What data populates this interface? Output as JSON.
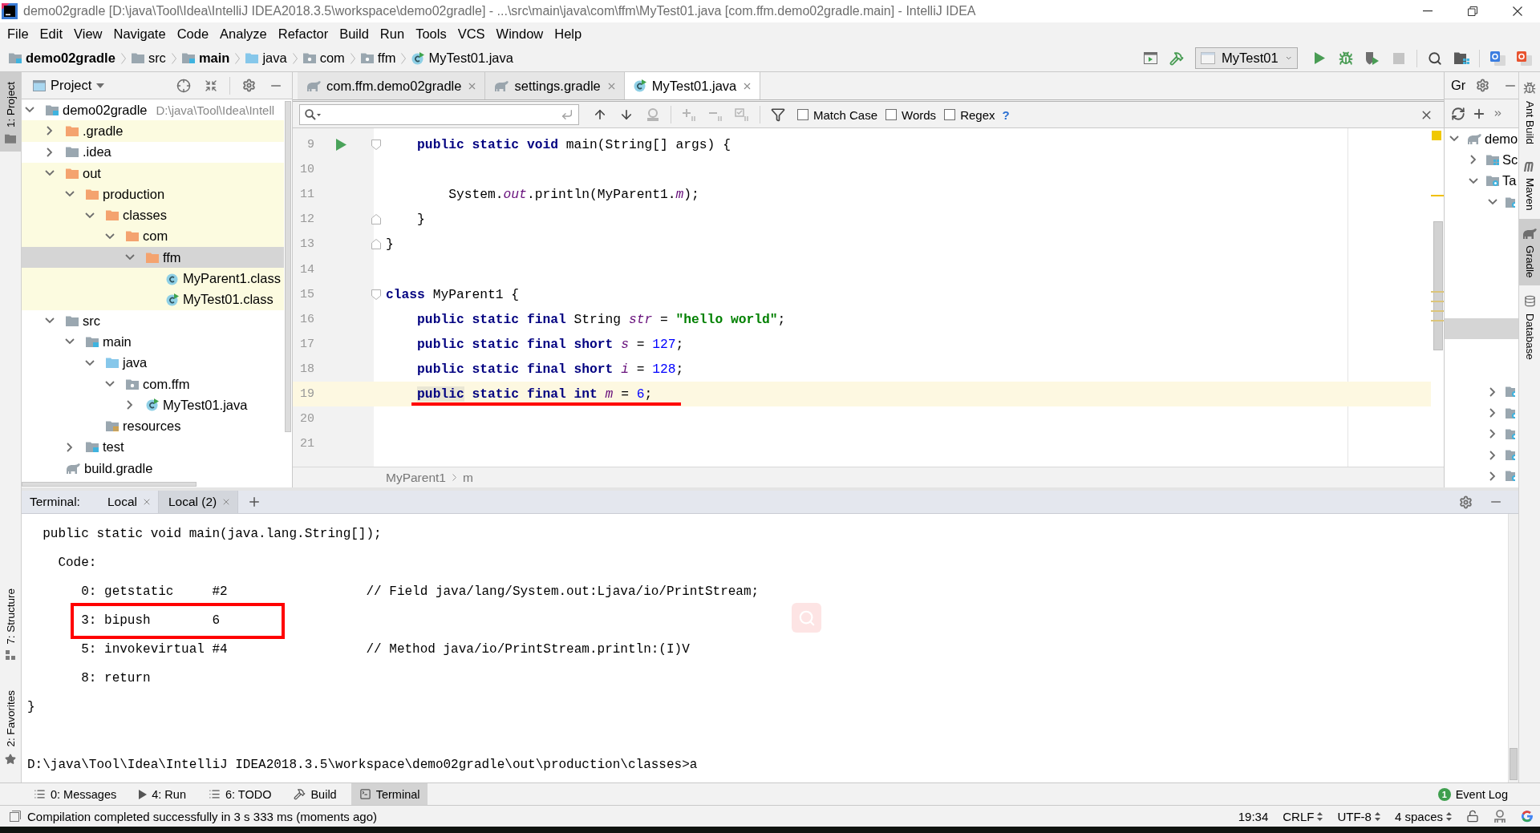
{
  "window": {
    "title": "demo02gradle [D:\\java\\Tool\\Idea\\IntelliJ IDEA2018.3.5\\workspace\\demo02gradle] - ...\\src\\main\\java\\com\\ffm\\MyTest01.java [com.ffm.demo02gradle.main] - IntelliJ IDEA"
  },
  "menu": [
    "File",
    "Edit",
    "View",
    "Navigate",
    "Code",
    "Analyze",
    "Refactor",
    "Build",
    "Run",
    "Tools",
    "VCS",
    "Window",
    "Help"
  ],
  "navbar": {
    "breadcrumbs": [
      {
        "label": "demo02gradle",
        "kind": "module"
      },
      {
        "label": "src",
        "kind": "folder"
      },
      {
        "label": "main",
        "kind": "module"
      },
      {
        "label": "java",
        "kind": "source"
      },
      {
        "label": "com",
        "kind": "package"
      },
      {
        "label": "ffm",
        "kind": "package"
      },
      {
        "label": "MyTest01.java",
        "kind": "runnable-class"
      }
    ],
    "run_config": "MyTest01"
  },
  "left_strip": {
    "top": [
      {
        "label": "1: Project",
        "kind": "project",
        "selected": true
      }
    ],
    "bottom": [
      {
        "label": "7: Structure",
        "kind": "structure",
        "selected": false
      },
      {
        "label": "2: Favorites",
        "kind": "favorites",
        "selected": false
      }
    ]
  },
  "project": {
    "title": "Project",
    "tree": [
      {
        "label": "demo02gradle",
        "kind": "module",
        "note": "D:\\java\\Tool\\Idea\\Intell",
        "expanded": true,
        "excluded": false,
        "selected": false,
        "children": [
          {
            "label": ".gradle",
            "kind": "excluded-folder",
            "expanded": false,
            "excluded": true,
            "selected": false
          },
          {
            "label": ".idea",
            "kind": "folder",
            "expanded": false,
            "excluded": false,
            "selected": false
          },
          {
            "label": "out",
            "kind": "excluded-folder",
            "expanded": true,
            "excluded": true,
            "selected": false,
            "children": [
              {
                "label": "production",
                "kind": "excluded-folder",
                "expanded": true,
                "excluded": true,
                "selected": false,
                "children": [
                  {
                    "label": "classes",
                    "kind": "excluded-folder",
                    "expanded": true,
                    "excluded": true,
                    "selected": false,
                    "children": [
                      {
                        "label": "com",
                        "kind": "excluded-folder",
                        "expanded": true,
                        "excluded": true,
                        "selected": false,
                        "children": [
                          {
                            "label": "ffm",
                            "kind": "excluded-folder",
                            "expanded": true,
                            "selected": true,
                            "children": [
                              {
                                "label": "MyParent1.class",
                                "kind": "class",
                                "excluded": true,
                                "selected": false
                              },
                              {
                                "label": "MyTest01.class",
                                "kind": "runnable-class",
                                "excluded": true,
                                "selected": false
                              }
                            ]
                          }
                        ]
                      }
                    ]
                  }
                ]
              }
            ]
          },
          {
            "label": "src",
            "kind": "folder",
            "expanded": true,
            "excluded": false,
            "selected": false,
            "children": [
              {
                "label": "main",
                "kind": "module-folder",
                "expanded": true,
                "excluded": false,
                "selected": false,
                "children": [
                  {
                    "label": "java",
                    "kind": "source",
                    "expanded": true,
                    "excluded": false,
                    "selected": false,
                    "children": [
                      {
                        "label": "com.ffm",
                        "kind": "package",
                        "expanded": true,
                        "excluded": false,
                        "selected": false,
                        "children": [
                          {
                            "label": "MyTest01.java",
                            "kind": "runnable-class",
                            "expanded": false,
                            "excluded": false,
                            "selected": false
                          }
                        ]
                      }
                    ]
                  },
                  {
                    "label": "resources",
                    "kind": "resources",
                    "excluded": false,
                    "selected": false
                  }
                ]
              },
              {
                "label": "test",
                "kind": "module-folder",
                "expanded": false,
                "excluded": false,
                "selected": false
              }
            ]
          },
          {
            "label": "build.gradle",
            "kind": "gradle",
            "excluded": false,
            "selected": false
          }
        ]
      }
    ]
  },
  "editor": {
    "tabs": [
      {
        "label": "com.ffm.demo02gradle",
        "kind": "gradle",
        "selected": false
      },
      {
        "label": "settings.gradle",
        "kind": "gradle",
        "selected": false
      },
      {
        "label": "MyTest01.java",
        "kind": "runnable-class",
        "selected": true
      }
    ],
    "search": {
      "options": [
        {
          "label": "Match Case",
          "checked": false
        },
        {
          "label": "Words",
          "checked": false
        },
        {
          "label": "Regex",
          "checked": false
        }
      ],
      "help": "?"
    },
    "lines": [
      {
        "number": "9",
        "current": false,
        "underlined": false,
        "run_marker": true,
        "fold_start": true,
        "tokens": [
          {
            "kind": "keyword",
            "text": "    public static void"
          },
          {
            "kind": "plain",
            "text": " main(String[] args) {"
          }
        ]
      },
      {
        "number": "10",
        "current": false,
        "underlined": false
      },
      {
        "number": "11",
        "current": false,
        "underlined": false,
        "tokens": [
          {
            "kind": "plain",
            "text": "        System."
          },
          {
            "kind": "field",
            "text": "out"
          },
          {
            "kind": "plain",
            "text": ".println(MyParent1."
          },
          {
            "kind": "field",
            "text": "m"
          },
          {
            "kind": "plain",
            "text": ");"
          }
        ]
      },
      {
        "number": "12",
        "current": false,
        "underlined": false,
        "fold_end": true,
        "tokens": [
          {
            "kind": "plain",
            "text": "    }"
          }
        ]
      },
      {
        "number": "13",
        "current": false,
        "underlined": false,
        "fold_end": true,
        "tokens": [
          {
            "kind": "plain",
            "text": "}"
          }
        ]
      },
      {
        "number": "14",
        "current": false,
        "underlined": false
      },
      {
        "number": "15",
        "current": false,
        "underlined": false,
        "fold_start": true,
        "tokens": [
          {
            "kind": "keyword",
            "text": "class"
          },
          {
            "kind": "plain",
            "text": " MyParent1 {"
          }
        ]
      },
      {
        "number": "16",
        "current": false,
        "underlined": false,
        "tokens": [
          {
            "kind": "keyword",
            "text": "    public static final"
          },
          {
            "kind": "plain",
            "text": " String "
          },
          {
            "kind": "field",
            "text": "str"
          },
          {
            "kind": "plain",
            "text": " = "
          },
          {
            "kind": "string",
            "text": "\"hello world\""
          },
          {
            "kind": "plain",
            "text": ";"
          }
        ]
      },
      {
        "number": "17",
        "current": false,
        "underlined": false,
        "tokens": [
          {
            "kind": "keyword",
            "text": "    public static final short "
          },
          {
            "kind": "field",
            "text": "s"
          },
          {
            "kind": "plain",
            "text": " = "
          },
          {
            "kind": "number",
            "text": "127"
          },
          {
            "kind": "plain",
            "text": ";"
          }
        ]
      },
      {
        "number": "18",
        "current": false,
        "underlined": false,
        "tokens": [
          {
            "kind": "keyword",
            "text": "    public static final short "
          },
          {
            "kind": "field",
            "text": "i"
          },
          {
            "kind": "plain",
            "text": " = "
          },
          {
            "kind": "number",
            "text": "128"
          },
          {
            "kind": "plain",
            "text": ";"
          }
        ]
      },
      {
        "number": "19",
        "current": true,
        "underlined": true,
        "tokens": [
          {
            "kind": "keyword",
            "text": "    public",
            "highlighted": true
          },
          {
            "kind": "keyword",
            "text": " static final int "
          },
          {
            "kind": "field",
            "text": "m"
          },
          {
            "kind": "plain",
            "text": " = "
          },
          {
            "kind": "number",
            "text": "6"
          },
          {
            "kind": "plain",
            "text": ";"
          }
        ]
      },
      {
        "number": "20",
        "current": false,
        "underlined": false
      },
      {
        "number": "21",
        "current": false,
        "underlined": false
      }
    ],
    "breadcrumbs": [
      "MyParent1",
      "m"
    ]
  },
  "gradle": {
    "title": "Gr",
    "tree": [
      {
        "label": "demo",
        "kind": "gradle",
        "expanded": true,
        "selected": false,
        "children": [
          {
            "label": "Sc",
            "kind": "source-sets",
            "expanded": false,
            "selected": false
          },
          {
            "label": "Ta",
            "kind": "tasks",
            "expanded": true,
            "selected": false,
            "children": [
              {
                "kind": "task-folder",
                "expanded": true,
                "selected": false,
                "children": [
                  {
                    "selected": false
                  },
                  {
                    "selected": false
                  },
                  {
                    "selected": false
                  },
                  {
                    "selected": false
                  },
                  {
                    "selected": false
                  },
                  {
                    "selected": true
                  },
                  {
                    "selected": false
                  },
                  {
                    "selected": false
                  }
                ]
              },
              {
                "kind": "task-folder",
                "expanded": false,
                "selected": false
              },
              {
                "kind": "task-folder",
                "expanded": false,
                "selected": false
              },
              {
                "kind": "task-folder",
                "expanded": false,
                "selected": false
              },
              {
                "kind": "task-folder",
                "expanded": false,
                "selected": false
              },
              {
                "kind": "task-folder",
                "expanded": false,
                "selected": false
              }
            ]
          }
        ]
      }
    ]
  },
  "right_strip": [
    {
      "label": "Ant Build",
      "kind": "ant",
      "selected": false
    },
    {
      "label": "Maven",
      "kind": "maven",
      "selected": false
    },
    {
      "label": "Gradle",
      "kind": "gradle",
      "selected": true
    },
    {
      "label": "Database",
      "kind": "database",
      "selected": false
    }
  ],
  "terminal": {
    "label": "Terminal:",
    "tabs": [
      {
        "label": "Local",
        "selected": false
      },
      {
        "label": "Local (2)",
        "selected": true
      }
    ],
    "lines": [
      {
        "text": "  public static void main(java.lang.String[]);",
        "boxed": false
      },
      {
        "text": "    Code:",
        "boxed": false
      },
      {
        "text": "       0: getstatic     #2                  // Field java/lang/System.out:Ljava/io/PrintStream;",
        "boxed": false
      },
      {
        "text": "       3: bipush        6",
        "boxed": true
      },
      {
        "text": "       5: invokevirtual #4                  // Method java/io/PrintStream.println:(I)V",
        "boxed": false
      },
      {
        "text": "       8: return",
        "boxed": false
      },
      {
        "text": "}",
        "boxed": false
      }
    ],
    "prompt": "D:\\java\\Tool\\Idea\\IntelliJ IDEA2018.3.5\\workspace\\demo02gradle\\out\\production\\classes>a"
  },
  "tool_tabs": [
    {
      "label": "0: Messages",
      "kind": "messages",
      "selected": false
    },
    {
      "label": "4: Run",
      "kind": "run",
      "selected": false
    },
    {
      "label": "6: TODO",
      "kind": "todo",
      "selected": false
    },
    {
      "label": "Build",
      "kind": "build",
      "selected": false
    },
    {
      "label": "Terminal",
      "kind": "terminal",
      "selected": true
    }
  ],
  "event_log": {
    "label": "Event Log",
    "count": "1"
  },
  "status_bar": {
    "message": "Compilation completed successfully in 3 s 333 ms (moments ago)",
    "position": "19:34",
    "line_separator": "CRLF",
    "encoding": "UTF-8",
    "indent": "4 spaces"
  }
}
